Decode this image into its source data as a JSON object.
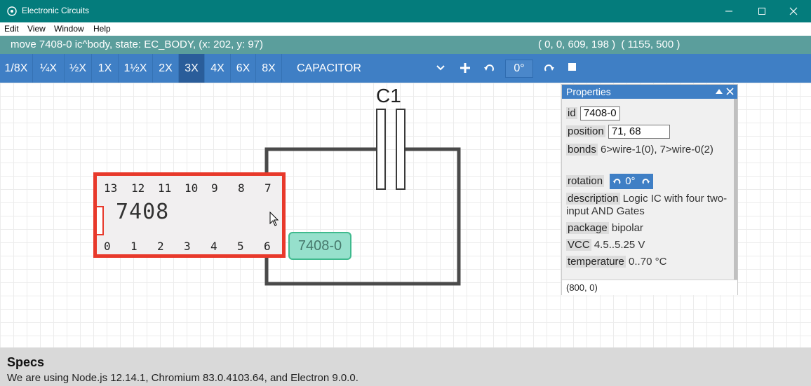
{
  "window": {
    "title": "Electronic Circuits",
    "icon": "atom-icon",
    "controls": [
      "minimize-icon",
      "maximize-icon",
      "close-icon"
    ]
  },
  "menu": {
    "items": [
      "Edit",
      "View",
      "Window",
      "Help"
    ]
  },
  "status": {
    "left": "move 7408-0 ic^body, state: EC_BODY, (x: 202, y: 97)",
    "right": "( 0, 0, 609, 198 )  ( 1155, 500 )"
  },
  "toolbar": {
    "zoom_levels": [
      "1/8X",
      "¼X",
      "½X",
      "1X",
      "1½X",
      "2X",
      "3X",
      "4X",
      "6X",
      "8X"
    ],
    "active_zoom": "3X",
    "component_select": "CAPACITOR",
    "angle": "0°",
    "icons": [
      "chevron-down-icon",
      "add-icon",
      "rotate-left-icon",
      "rotate-right-icon",
      "stop-icon"
    ]
  },
  "canvas": {
    "capacitor_label": "C1",
    "chip": {
      "name": "7408",
      "pins_top": [
        "13",
        "12",
        "11",
        "10",
        "9",
        "8",
        "7"
      ],
      "pins_bottom": [
        "0",
        "1",
        "2",
        "3",
        "4",
        "5",
        "6"
      ],
      "tag": "7408-0"
    }
  },
  "properties": {
    "title": "Properties",
    "id_label": "id",
    "id_value": "7408-0",
    "position_label": "position",
    "position_value": "71, 68",
    "bonds_label": "bonds",
    "bonds_value": "6>wire-1(0), 7>wire-0(2)",
    "rotation_label": "rotation",
    "rotation_value": "0°",
    "description_label": "description",
    "description_value": "Logic IC with four two-input AND Gates",
    "package_label": "package",
    "package_value": "bipolar",
    "vcc_label": "VCC",
    "vcc_value": "4.5..5.25 V",
    "temperature_label": "temperature",
    "temperature_value": "0..70 °C",
    "footer": "(800, 0)"
  },
  "specs": {
    "heading": "Specs",
    "text": "We are using Node.js 12.14.1, Chromium 83.0.4103.64, and Electron 9.0.0."
  }
}
